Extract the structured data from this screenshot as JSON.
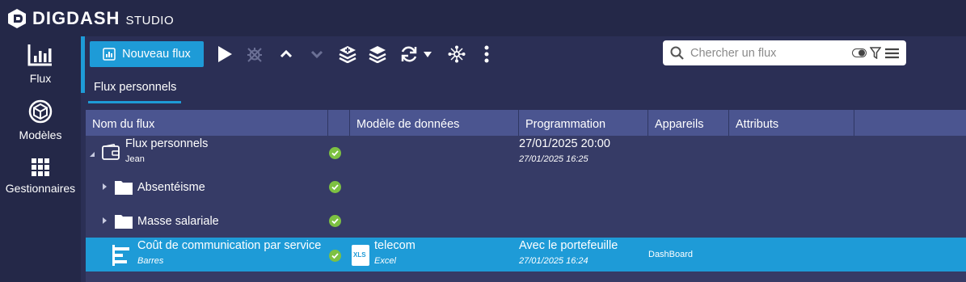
{
  "app": {
    "logo_text": "DIGDASH",
    "logo_sub": "STUDIO"
  },
  "nav": {
    "items": [
      {
        "label": "Flux",
        "icon": "bar-chart-icon",
        "active": true
      },
      {
        "label": "Modèles",
        "icon": "cube-icon",
        "active": false
      },
      {
        "label": "Gestionnaires",
        "icon": "grid-icon",
        "active": false
      }
    ]
  },
  "toolbar": {
    "new_flow_label": "Nouveau flux",
    "icons": [
      "play-icon",
      "bug-icon",
      "chevron-up-icon",
      "chevron-down-icon",
      "layers-add-icon",
      "layers-icon",
      "refresh-icon",
      "dropdown-caret-icon",
      "network-icon",
      "more-vertical-icon"
    ],
    "search_placeholder": "Chercher un flux",
    "search_value": ""
  },
  "tabs": [
    {
      "label": "Flux personnels",
      "active": true
    }
  ],
  "grid": {
    "columns": [
      "Nom du flux",
      "",
      "Modèle de données",
      "Programmation",
      "Appareils",
      "Attributs"
    ],
    "rows": [
      {
        "name": "Flux personnels",
        "sub": "Jean",
        "status": "ok",
        "model": "",
        "model_sub": "",
        "schedule": "27/01/2025 20:00",
        "schedule_sub": "27/01/2025 16:25",
        "devices": "",
        "attributes": ""
      },
      {
        "name": "Absentéisme",
        "sub": "",
        "status": "ok",
        "model": "",
        "model_sub": "",
        "schedule": "",
        "schedule_sub": "",
        "devices": "",
        "attributes": ""
      },
      {
        "name": "Masse salariale",
        "sub": "",
        "status": "ok",
        "model": "",
        "model_sub": "",
        "schedule": "",
        "schedule_sub": "",
        "devices": "",
        "attributes": ""
      },
      {
        "name": "Coût de communication par service",
        "sub": "Barres",
        "status": "ok",
        "model": "telecom",
        "model_sub": "Excel",
        "model_badge": "XLS",
        "schedule": "Avec le portefeuille",
        "schedule_sub": "27/01/2025 16:24",
        "devices": "DashBoard",
        "attributes": ""
      }
    ]
  },
  "colors": {
    "accent": "#1e9bd7",
    "status_ok": "#7dc142",
    "header_bg": "#242848",
    "grid_head": "#4b5590",
    "xls_badge": "#1e9bd7"
  }
}
